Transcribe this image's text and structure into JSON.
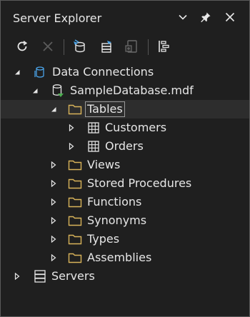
{
  "panel": {
    "title": "Server Explorer"
  },
  "toolbar": {
    "buttons": [
      {
        "name": "refresh-icon"
      },
      {
        "name": "stop-icon"
      },
      {
        "name": "connect-to-database-icon"
      },
      {
        "name": "connect-to-server-icon"
      },
      {
        "name": "new-query-icon"
      },
      {
        "name": "properties-icon"
      }
    ]
  },
  "tree": {
    "data_connections": "Data Connections",
    "database": "SampleDatabase.mdf",
    "tables": "Tables",
    "customers": "Customers",
    "orders": "Orders",
    "views": "Views",
    "stored_procedures": "Stored Procedures",
    "functions": "Functions",
    "synonyms": "Synonyms",
    "types": "Types",
    "assemblies": "Assemblies",
    "servers": "Servers"
  },
  "colors": {
    "background": "#1f1f1f",
    "folder": "#d9b45a",
    "db_blue": "#4aa3e8",
    "connected_green": "#4caf50",
    "selected_row": "#2d2d2d"
  }
}
